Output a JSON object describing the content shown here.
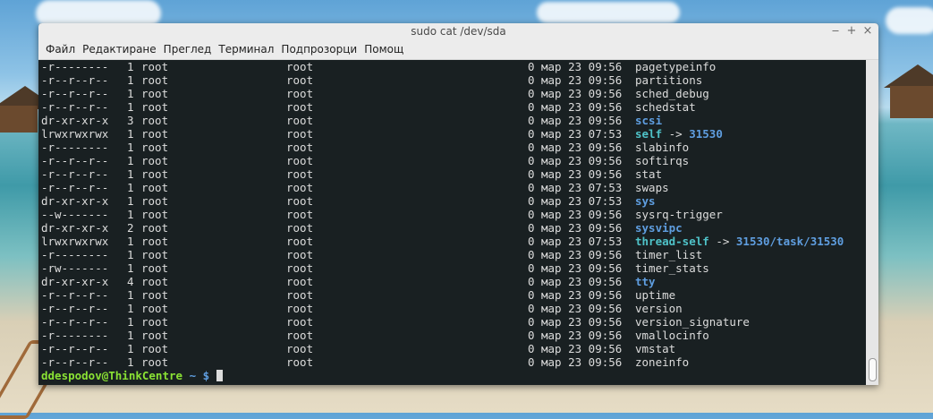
{
  "window": {
    "title": "sudo cat /dev/sda",
    "controls": {
      "minimize": "‒",
      "maximize": "+",
      "close": "×"
    }
  },
  "menu": [
    "Файл",
    "Редактиране",
    "Преглед",
    "Терминал",
    "Подпрозорци",
    "Помощ"
  ],
  "listing": [
    {
      "perm": "-r--------",
      "links": "1",
      "owner": "root",
      "group": "root",
      "size": "0",
      "date": "мар 23 09:56",
      "name": "pagetypeinfo",
      "type": "file"
    },
    {
      "perm": "-r--r--r--",
      "links": "1",
      "owner": "root",
      "group": "root",
      "size": "0",
      "date": "мар 23 09:56",
      "name": "partitions",
      "type": "file"
    },
    {
      "perm": "-r--r--r--",
      "links": "1",
      "owner": "root",
      "group": "root",
      "size": "0",
      "date": "мар 23 09:56",
      "name": "sched_debug",
      "type": "file"
    },
    {
      "perm": "-r--r--r--",
      "links": "1",
      "owner": "root",
      "group": "root",
      "size": "0",
      "date": "мар 23 09:56",
      "name": "schedstat",
      "type": "file"
    },
    {
      "perm": "dr-xr-xr-x",
      "links": "3",
      "owner": "root",
      "group": "root",
      "size": "0",
      "date": "мар 23 09:56",
      "name": "scsi",
      "type": "dir"
    },
    {
      "perm": "lrwxrwxrwx",
      "links": "1",
      "owner": "root",
      "group": "root",
      "size": "0",
      "date": "мар 23 07:53",
      "name": "self",
      "type": "link",
      "target": "31530"
    },
    {
      "perm": "-r--------",
      "links": "1",
      "owner": "root",
      "group": "root",
      "size": "0",
      "date": "мар 23 09:56",
      "name": "slabinfo",
      "type": "file"
    },
    {
      "perm": "-r--r--r--",
      "links": "1",
      "owner": "root",
      "group": "root",
      "size": "0",
      "date": "мар 23 09:56",
      "name": "softirqs",
      "type": "file"
    },
    {
      "perm": "-r--r--r--",
      "links": "1",
      "owner": "root",
      "group": "root",
      "size": "0",
      "date": "мар 23 09:56",
      "name": "stat",
      "type": "file"
    },
    {
      "perm": "-r--r--r--",
      "links": "1",
      "owner": "root",
      "group": "root",
      "size": "0",
      "date": "мар 23 07:53",
      "name": "swaps",
      "type": "file"
    },
    {
      "perm": "dr-xr-xr-x",
      "links": "1",
      "owner": "root",
      "group": "root",
      "size": "0",
      "date": "мар 23 07:53",
      "name": "sys",
      "type": "dir"
    },
    {
      "perm": "--w-------",
      "links": "1",
      "owner": "root",
      "group": "root",
      "size": "0",
      "date": "мар 23 09:56",
      "name": "sysrq-trigger",
      "type": "file"
    },
    {
      "perm": "dr-xr-xr-x",
      "links": "2",
      "owner": "root",
      "group": "root",
      "size": "0",
      "date": "мар 23 09:56",
      "name": "sysvipc",
      "type": "dir"
    },
    {
      "perm": "lrwxrwxrwx",
      "links": "1",
      "owner": "root",
      "group": "root",
      "size": "0",
      "date": "мар 23 07:53",
      "name": "thread-self",
      "type": "link",
      "target": "31530/task/31530"
    },
    {
      "perm": "-r--------",
      "links": "1",
      "owner": "root",
      "group": "root",
      "size": "0",
      "date": "мар 23 09:56",
      "name": "timer_list",
      "type": "file"
    },
    {
      "perm": "-rw-------",
      "links": "1",
      "owner": "root",
      "group": "root",
      "size": "0",
      "date": "мар 23 09:56",
      "name": "timer_stats",
      "type": "file"
    },
    {
      "perm": "dr-xr-xr-x",
      "links": "4",
      "owner": "root",
      "group": "root",
      "size": "0",
      "date": "мар 23 09:56",
      "name": "tty",
      "type": "dir"
    },
    {
      "perm": "-r--r--r--",
      "links": "1",
      "owner": "root",
      "group": "root",
      "size": "0",
      "date": "мар 23 09:56",
      "name": "uptime",
      "type": "file"
    },
    {
      "perm": "-r--r--r--",
      "links": "1",
      "owner": "root",
      "group": "root",
      "size": "0",
      "date": "мар 23 09:56",
      "name": "version",
      "type": "file"
    },
    {
      "perm": "-r--r--r--",
      "links": "1",
      "owner": "root",
      "group": "root",
      "size": "0",
      "date": "мар 23 09:56",
      "name": "version_signature",
      "type": "file"
    },
    {
      "perm": "-r--------",
      "links": "1",
      "owner": "root",
      "group": "root",
      "size": "0",
      "date": "мар 23 09:56",
      "name": "vmallocinfo",
      "type": "file"
    },
    {
      "perm": "-r--r--r--",
      "links": "1",
      "owner": "root",
      "group": "root",
      "size": "0",
      "date": "мар 23 09:56",
      "name": "vmstat",
      "type": "file"
    },
    {
      "perm": "-r--r--r--",
      "links": "1",
      "owner": "root",
      "group": "root",
      "size": "0",
      "date": "мар 23 09:56",
      "name": "zoneinfo",
      "type": "file"
    }
  ],
  "prompt": {
    "user_host": "ddespodov@ThinkCentre",
    "path": "~",
    "symbol": "$"
  },
  "colors": {
    "directory": "#5f9ee0",
    "symlink": "#4fc2c8",
    "prompt_user": "#8ae234",
    "text": "#dcdcdc"
  }
}
